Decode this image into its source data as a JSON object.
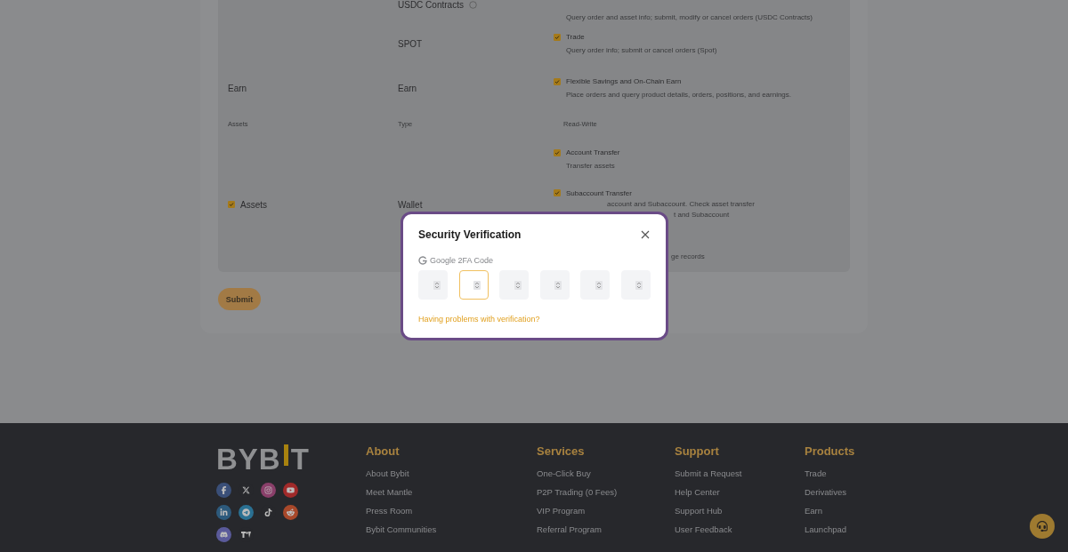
{
  "permissions": {
    "rows": [
      {
        "kind": "section",
        "asset": "",
        "groups": [
          {
            "type": "USDC Contracts",
            "info": true,
            "items": [
              {
                "kind": "desc_only",
                "desc": "Query order and asset info; submit, modify or cancel orders (USDC Contracts)"
              }
            ]
          },
          {
            "type": "SPOT",
            "info": false,
            "items": [
              {
                "kind": "full",
                "label": "Trade",
                "checked": true,
                "desc": "Query order info; submit or cancel orders (Spot)"
              }
            ]
          }
        ]
      },
      {
        "kind": "section",
        "asset": "Earn",
        "groups": [
          {
            "type": "Earn",
            "info": false,
            "items": [
              {
                "kind": "full",
                "label": "Flexible Savings and On-Chain Earn",
                "checked": true,
                "desc": "Place orders and query product details, orders, positions, and earnings."
              }
            ]
          }
        ]
      },
      {
        "kind": "header",
        "columns": [
          "Assets",
          "Type",
          "Read-Write"
        ]
      },
      {
        "kind": "section",
        "asset": "Assets",
        "asset_checked": true,
        "groups": [
          {
            "type": "Wallet",
            "info": false,
            "items": [
              {
                "kind": "full",
                "label": "Account Transfer",
                "checked": true,
                "desc": "Transfer assets"
              },
              {
                "kind": "covered",
                "label": "Subaccount Transfer",
                "checked": true,
                "fragments": [
                  "account and Subaccount. Check asset transfer",
                  "t and Subaccount"
                ]
              },
              {
                "kind": "covered_nolabel",
                "fragments": [
                  "ge records"
                ]
              }
            ]
          }
        ]
      }
    ],
    "submit": "Submit"
  },
  "modal": {
    "title": "Security Verification",
    "field_label": "Google 2FA Code",
    "digits": [
      {
        "selected": false
      },
      {
        "selected": true
      },
      {
        "selected": false
      },
      {
        "selected": false
      },
      {
        "selected": false
      },
      {
        "selected": false
      }
    ],
    "help_link": "Having problems with verification?"
  },
  "footer": {
    "logo_left": "BYB",
    "logo_right": "T",
    "columns": [
      {
        "heading": "About",
        "links": [
          "About Bybit",
          "Meet Mantle",
          "Press Room",
          "Bybit Communities"
        ]
      },
      {
        "heading": "Services",
        "links": [
          "One-Click Buy",
          "P2P Trading (0 Fees)",
          "VIP Program",
          "Referral Program"
        ]
      },
      {
        "heading": "Support",
        "links": [
          "Submit a Request",
          "Help Center",
          "Support Hub",
          "User Feedback"
        ]
      },
      {
        "heading": "Products",
        "links": [
          "Trade",
          "Derivatives",
          "Earn",
          "Launchpad"
        ]
      }
    ]
  }
}
